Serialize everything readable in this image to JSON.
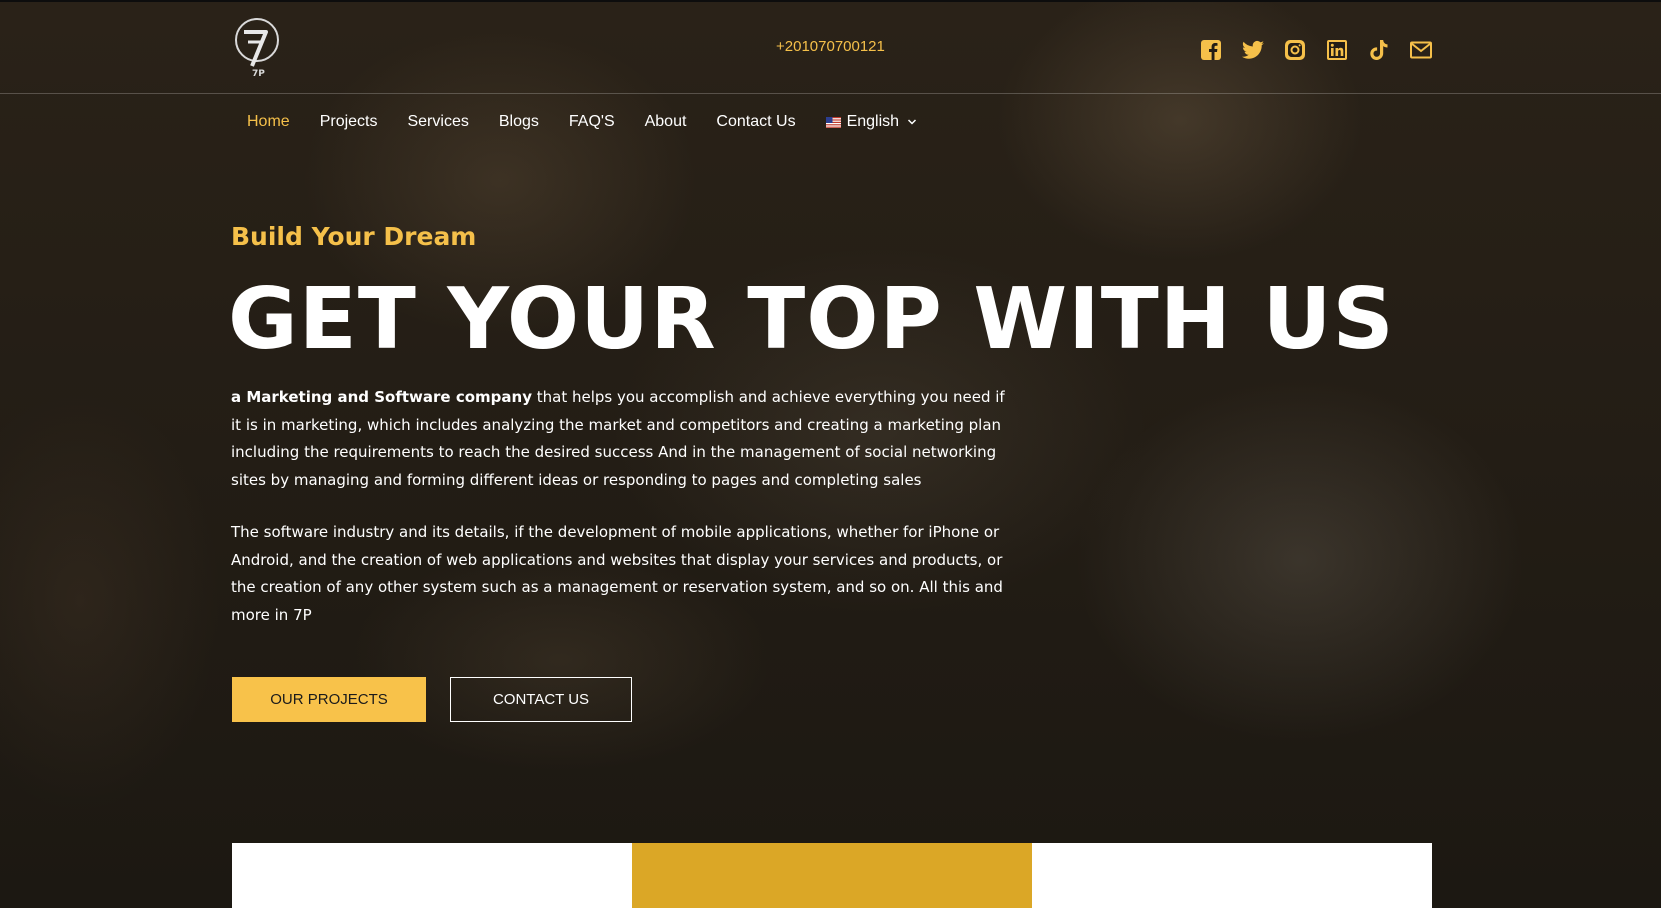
{
  "header": {
    "logo_text": "7P",
    "phone": "+201070700121",
    "socials": [
      {
        "name": "facebook-icon"
      },
      {
        "name": "twitter-icon"
      },
      {
        "name": "instagram-icon"
      },
      {
        "name": "linkedin-icon"
      },
      {
        "name": "tiktok-icon"
      },
      {
        "name": "mail-icon"
      }
    ]
  },
  "nav": {
    "items": [
      "Home",
      "Projects",
      "Services",
      "Blogs",
      "FAQ'S",
      "About",
      "Contact Us"
    ],
    "active": "Home",
    "language": "English"
  },
  "hero": {
    "kicker": "Build Your Dream",
    "headline": "GET YOUR TOP WITH US",
    "para1_bold": "a Marketing and Software company",
    "para1_rest": " that helps you accomplish and achieve everything you need if it is in marketing, which includes analyzing the market and competitors and creating a marketing plan including the requirements to reach the desired success And in the management of social networking sites by managing and forming different ideas or responding to pages and completing sales",
    "para2": "The software industry and its details, if the development of mobile applications, whether for iPhone or Android, and the creation of web applications and websites that display your services and products, or the creation of any other system such as a management or reservation system, and so on. All this and more in 7P",
    "primary_button": "OUR PROJECTS",
    "secondary_button": "CONTACT US"
  },
  "colors": {
    "accent": "#f5c04a",
    "button": "#f8c24a",
    "card_gold": "#dba726"
  }
}
